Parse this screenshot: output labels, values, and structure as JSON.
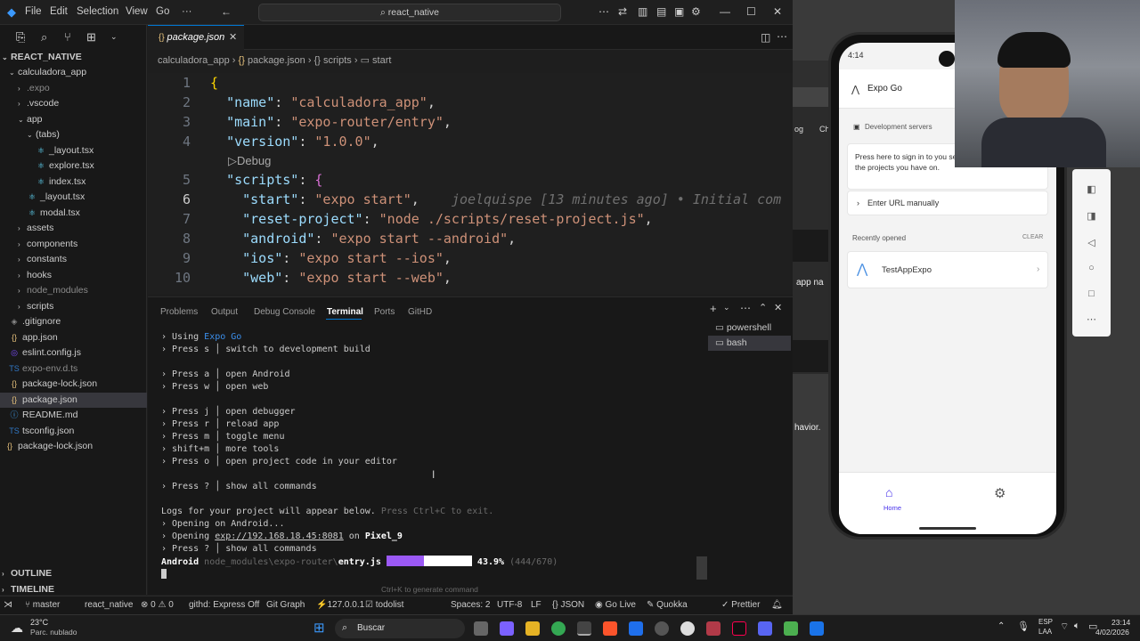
{
  "titlebar": {
    "menus": [
      "File",
      "Edit",
      "Selection",
      "View",
      "Go",
      "···"
    ],
    "search_text": "react_native"
  },
  "sidebar": {
    "root": "REACT_NATIVE",
    "items": [
      {
        "label": "calculadora_app",
        "color": "#cccccc"
      },
      {
        "label": ".expo",
        "color": "#8b8b8b"
      },
      {
        "label": ".vscode",
        "color": "#cccccc"
      },
      {
        "label": "app",
        "color": "#cccccc"
      },
      {
        "label": "(tabs)",
        "color": "#cccccc"
      },
      {
        "label": "_layout.tsx",
        "color": "#cccccc"
      },
      {
        "label": "explore.tsx",
        "color": "#cccccc"
      },
      {
        "label": "index.tsx",
        "color": "#cccccc"
      },
      {
        "label": "_layout.tsx",
        "color": "#cccccc"
      },
      {
        "label": "modal.tsx",
        "color": "#cccccc"
      },
      {
        "label": "assets",
        "color": "#cccccc"
      },
      {
        "label": "components",
        "color": "#cccccc"
      },
      {
        "label": "constants",
        "color": "#cccccc"
      },
      {
        "label": "hooks",
        "color": "#cccccc"
      },
      {
        "label": "node_modules",
        "color": "#8b8b8b"
      },
      {
        "label": "scripts",
        "color": "#cccccc"
      },
      {
        "label": ".gitignore",
        "color": "#cccccc"
      },
      {
        "label": "app.json",
        "color": "#cccccc"
      },
      {
        "label": "eslint.config.js",
        "color": "#cccccc"
      },
      {
        "label": "expo-env.d.ts",
        "color": "#8b8b8b"
      },
      {
        "label": "package-lock.json",
        "color": "#cccccc"
      },
      {
        "label": "package.json",
        "color": "#cccccc"
      },
      {
        "label": "README.md",
        "color": "#cccccc"
      },
      {
        "label": "tsconfig.json",
        "color": "#cccccc"
      },
      {
        "label": "package-lock.json",
        "color": "#cccccc"
      }
    ],
    "outline": "OUTLINE",
    "timeline": "TIMELINE"
  },
  "editor": {
    "tab_label": "package.json",
    "breadcrumb": [
      "calculadora_app",
      "package.json",
      "scripts",
      "start"
    ],
    "codelens": "Debug",
    "blame": "joelquispe [13 minutes ago] • Initial com",
    "lines": [
      {
        "n": "1",
        "text": "{"
      },
      {
        "n": "2",
        "key": "\"name\"",
        "val": "\"calculadora_app\""
      },
      {
        "n": "3",
        "key": "\"main\"",
        "val": "\"expo-router/entry\""
      },
      {
        "n": "4",
        "key": "\"version\"",
        "val": "\"1.0.0\""
      },
      {
        "n": "5",
        "key": "\"scripts\""
      },
      {
        "n": "6",
        "key": "\"start\"",
        "val": "\"expo start\""
      },
      {
        "n": "7",
        "key": "\"reset-project\"",
        "val": "\"node ./scripts/reset-project.js\""
      },
      {
        "n": "8",
        "key": "\"android\"",
        "val": "\"expo start --android\""
      },
      {
        "n": "9",
        "key": "\"ios\"",
        "val": "\"expo start --ios\""
      },
      {
        "n": "10",
        "key": "\"web\"",
        "val": "\"expo start --web\""
      }
    ]
  },
  "panel": {
    "tabs": [
      "Problems",
      "Output",
      "Debug Console",
      "Terminal",
      "Ports",
      "GitHD"
    ],
    "active_tab": "Terminal",
    "terminals": [
      "powershell",
      "bash"
    ],
    "hint": "Ctrl+K to generate command",
    "lines": {
      "using": "› Using ",
      "using_link": "Expo Go",
      "press_s": "› Press s │ switch to development build",
      "press_a": "› Press a │ open Android",
      "press_w": "› Press w │ open web",
      "press_j": "› Press j │ open debugger",
      "press_r": "› Press r │ reload app",
      "press_m": "› Press m │ toggle menu",
      "press_shift": "› shift+m │ more tools",
      "press_o": "› Press o │ open project code in your editor",
      "press_q": "› Press ? │ show all commands",
      "logs": "Logs for your project will appear below. ",
      "logs_dim": "Press Ctrl+C to exit.",
      "opening_android": "› Opening on Android...",
      "opening_url_pre": "› Opening ",
      "opening_url": "exp://192.168.18.45:8081",
      "opening_on": " on ",
      "opening_device": "Pixel_9",
      "press_q2": "› Press ? │ show all commands",
      "bundle_platform": "Android ",
      "bundle_path": "node_modules\\expo-router\\",
      "bundle_file": "entry.js",
      "bundle_pct": "43.9%",
      "bundle_count": "(444/670)",
      "bundle_progress": 0.439
    }
  },
  "statusbar": {
    "branch": "master",
    "folder": "react_native",
    "problems": "⊗ 0 ⚠ 0",
    "githd": "githd: Express Off",
    "gitgraph": "Git Graph",
    "host": "127.0.0.1",
    "todolist": "todolist",
    "spaces": "Spaces: 2",
    "encoding": "UTF-8",
    "eol": "LF",
    "lang": "JSON",
    "golive": "Go Live",
    "quokka": "Quokka",
    "prettier": "Prettier"
  },
  "background_window": {
    "labels": [
      "og",
      "Ch",
      "app na",
      "havior."
    ]
  },
  "phone": {
    "time": "4:14",
    "app_title": "Expo Go",
    "dev_servers": "Development servers",
    "signin_text": "Press here to sign in to you see the projects you have on.",
    "enter_url": "Enter URL manually",
    "recently_opened": "Recently opened",
    "clear": "CLEAR",
    "project": "TestAppExpo",
    "home": "Home"
  },
  "taskbar": {
    "weather_temp": "23°C",
    "weather_desc": "Parc. nublado",
    "search": "Buscar",
    "lang": "ESP",
    "lang2": "LAA",
    "time": "23:14",
    "date": "4/02/2026"
  },
  "colors": {
    "accent": "#0078d4",
    "progress_fill": "#9b59f5",
    "expo_blue": "#4630eb"
  }
}
